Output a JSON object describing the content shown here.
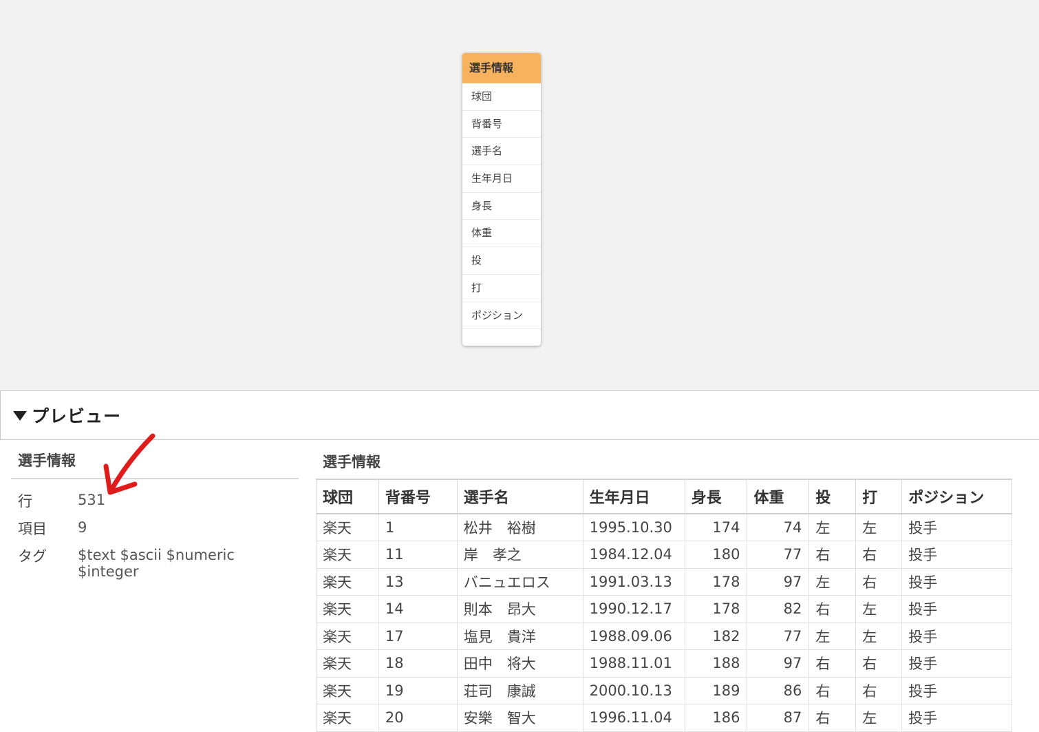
{
  "canvas": {
    "table_card": {
      "title": "選手情報",
      "fields": [
        "球団",
        "背番号",
        "選手名",
        "生年月日",
        "身長",
        "体重",
        "投",
        "打",
        "ポジション"
      ]
    }
  },
  "preview": {
    "toggle_label": "プレビュー",
    "summary": {
      "title": "選手情報",
      "rows": [
        {
          "key": "行",
          "value": "531"
        },
        {
          "key": "項目",
          "value": "9"
        },
        {
          "key": "タグ",
          "value": "$text $ascii $numeric $integer"
        }
      ]
    },
    "table": {
      "title": "選手情報",
      "columns": [
        "球団",
        "背番号",
        "選手名",
        "生年月日",
        "身長",
        "体重",
        "投",
        "打",
        "ポジション"
      ],
      "rows": [
        [
          "楽天",
          "1",
          "松井　裕樹",
          "1995.10.30",
          "174",
          "74",
          "左",
          "左",
          "投手"
        ],
        [
          "楽天",
          "11",
          "岸　孝之",
          "1984.12.04",
          "180",
          "77",
          "右",
          "右",
          "投手"
        ],
        [
          "楽天",
          "13",
          "バニュエロス",
          "1991.03.13",
          "178",
          "97",
          "左",
          "右",
          "投手"
        ],
        [
          "楽天",
          "14",
          "則本　昂大",
          "1990.12.17",
          "178",
          "82",
          "右",
          "左",
          "投手"
        ],
        [
          "楽天",
          "17",
          "塩見　貴洋",
          "1988.09.06",
          "182",
          "77",
          "左",
          "左",
          "投手"
        ],
        [
          "楽天",
          "18",
          "田中　将大",
          "1988.11.01",
          "188",
          "97",
          "右",
          "右",
          "投手"
        ],
        [
          "楽天",
          "19",
          "荘司　康誠",
          "2000.10.13",
          "189",
          "86",
          "右",
          "右",
          "投手"
        ],
        [
          "楽天",
          "20",
          "安樂　智大",
          "1996.11.04",
          "186",
          "87",
          "右",
          "左",
          "投手"
        ]
      ]
    }
  },
  "colors": {
    "card_header": "#f8b15c",
    "canvas_bg": "#f2f2f2",
    "annotation_arrow": "#e01b1b"
  }
}
